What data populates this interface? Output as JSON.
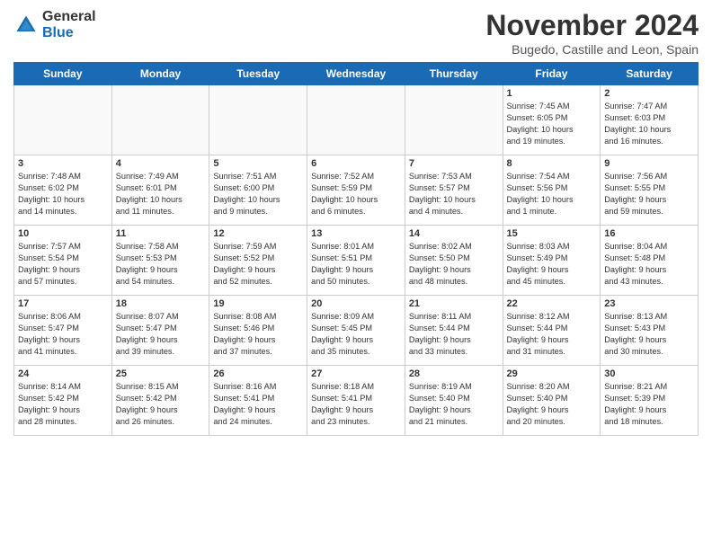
{
  "logo": {
    "line1": "General",
    "line2": "Blue"
  },
  "title": "November 2024",
  "subtitle": "Bugedo, Castille and Leon, Spain",
  "weekdays": [
    "Sunday",
    "Monday",
    "Tuesday",
    "Wednesday",
    "Thursday",
    "Friday",
    "Saturday"
  ],
  "weeks": [
    [
      {
        "day": "",
        "info": ""
      },
      {
        "day": "",
        "info": ""
      },
      {
        "day": "",
        "info": ""
      },
      {
        "day": "",
        "info": ""
      },
      {
        "day": "",
        "info": ""
      },
      {
        "day": "1",
        "info": "Sunrise: 7:45 AM\nSunset: 6:05 PM\nDaylight: 10 hours\nand 19 minutes."
      },
      {
        "day": "2",
        "info": "Sunrise: 7:47 AM\nSunset: 6:03 PM\nDaylight: 10 hours\nand 16 minutes."
      }
    ],
    [
      {
        "day": "3",
        "info": "Sunrise: 7:48 AM\nSunset: 6:02 PM\nDaylight: 10 hours\nand 14 minutes."
      },
      {
        "day": "4",
        "info": "Sunrise: 7:49 AM\nSunset: 6:01 PM\nDaylight: 10 hours\nand 11 minutes."
      },
      {
        "day": "5",
        "info": "Sunrise: 7:51 AM\nSunset: 6:00 PM\nDaylight: 10 hours\nand 9 minutes."
      },
      {
        "day": "6",
        "info": "Sunrise: 7:52 AM\nSunset: 5:59 PM\nDaylight: 10 hours\nand 6 minutes."
      },
      {
        "day": "7",
        "info": "Sunrise: 7:53 AM\nSunset: 5:57 PM\nDaylight: 10 hours\nand 4 minutes."
      },
      {
        "day": "8",
        "info": "Sunrise: 7:54 AM\nSunset: 5:56 PM\nDaylight: 10 hours\nand 1 minute."
      },
      {
        "day": "9",
        "info": "Sunrise: 7:56 AM\nSunset: 5:55 PM\nDaylight: 9 hours\nand 59 minutes."
      }
    ],
    [
      {
        "day": "10",
        "info": "Sunrise: 7:57 AM\nSunset: 5:54 PM\nDaylight: 9 hours\nand 57 minutes."
      },
      {
        "day": "11",
        "info": "Sunrise: 7:58 AM\nSunset: 5:53 PM\nDaylight: 9 hours\nand 54 minutes."
      },
      {
        "day": "12",
        "info": "Sunrise: 7:59 AM\nSunset: 5:52 PM\nDaylight: 9 hours\nand 52 minutes."
      },
      {
        "day": "13",
        "info": "Sunrise: 8:01 AM\nSunset: 5:51 PM\nDaylight: 9 hours\nand 50 minutes."
      },
      {
        "day": "14",
        "info": "Sunrise: 8:02 AM\nSunset: 5:50 PM\nDaylight: 9 hours\nand 48 minutes."
      },
      {
        "day": "15",
        "info": "Sunrise: 8:03 AM\nSunset: 5:49 PM\nDaylight: 9 hours\nand 45 minutes."
      },
      {
        "day": "16",
        "info": "Sunrise: 8:04 AM\nSunset: 5:48 PM\nDaylight: 9 hours\nand 43 minutes."
      }
    ],
    [
      {
        "day": "17",
        "info": "Sunrise: 8:06 AM\nSunset: 5:47 PM\nDaylight: 9 hours\nand 41 minutes."
      },
      {
        "day": "18",
        "info": "Sunrise: 8:07 AM\nSunset: 5:47 PM\nDaylight: 9 hours\nand 39 minutes."
      },
      {
        "day": "19",
        "info": "Sunrise: 8:08 AM\nSunset: 5:46 PM\nDaylight: 9 hours\nand 37 minutes."
      },
      {
        "day": "20",
        "info": "Sunrise: 8:09 AM\nSunset: 5:45 PM\nDaylight: 9 hours\nand 35 minutes."
      },
      {
        "day": "21",
        "info": "Sunrise: 8:11 AM\nSunset: 5:44 PM\nDaylight: 9 hours\nand 33 minutes."
      },
      {
        "day": "22",
        "info": "Sunrise: 8:12 AM\nSunset: 5:44 PM\nDaylight: 9 hours\nand 31 minutes."
      },
      {
        "day": "23",
        "info": "Sunrise: 8:13 AM\nSunset: 5:43 PM\nDaylight: 9 hours\nand 30 minutes."
      }
    ],
    [
      {
        "day": "24",
        "info": "Sunrise: 8:14 AM\nSunset: 5:42 PM\nDaylight: 9 hours\nand 28 minutes."
      },
      {
        "day": "25",
        "info": "Sunrise: 8:15 AM\nSunset: 5:42 PM\nDaylight: 9 hours\nand 26 minutes."
      },
      {
        "day": "26",
        "info": "Sunrise: 8:16 AM\nSunset: 5:41 PM\nDaylight: 9 hours\nand 24 minutes."
      },
      {
        "day": "27",
        "info": "Sunrise: 8:18 AM\nSunset: 5:41 PM\nDaylight: 9 hours\nand 23 minutes."
      },
      {
        "day": "28",
        "info": "Sunrise: 8:19 AM\nSunset: 5:40 PM\nDaylight: 9 hours\nand 21 minutes."
      },
      {
        "day": "29",
        "info": "Sunrise: 8:20 AM\nSunset: 5:40 PM\nDaylight: 9 hours\nand 20 minutes."
      },
      {
        "day": "30",
        "info": "Sunrise: 8:21 AM\nSunset: 5:39 PM\nDaylight: 9 hours\nand 18 minutes."
      }
    ]
  ]
}
